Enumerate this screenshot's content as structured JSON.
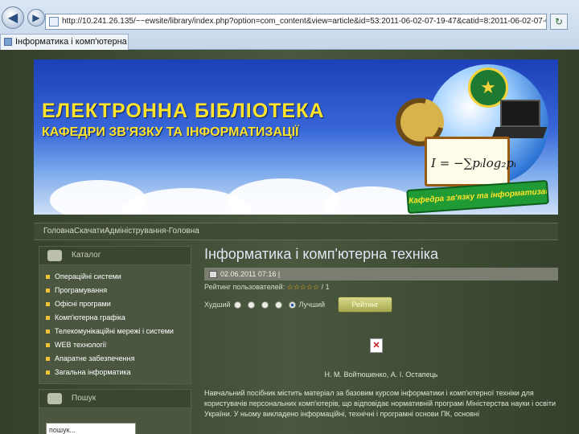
{
  "browser": {
    "url": "http://10.241.26.135/~~ewsite/library/index.php?option=com_content&view=article&id=53:2011-06-02-07-19-47&catid=8:2011-06-02-07-08-57&Itemid=",
    "tab_title": "Інформатика і комп'ютерна",
    "favorites": [
      "...",
      "...",
      "...",
      "...",
      "..."
    ]
  },
  "banner": {
    "title": "ЕЛЕКТРОННА БІБЛІОТЕКА",
    "subtitle": "КАФЕДРИ ЗВ'ЯЗКУ ТА ІНФОРМАТИЗАЦІЇ",
    "formula": "I = −∑pᵢlog₂pᵢ",
    "ribbon": "Кафедра зв'язку та інформатизації"
  },
  "breadcrumb": "ГоловнаСкачатиАдміністрування-Головна",
  "sidebar": {
    "catalog_title": "Каталог",
    "catalog_items": [
      "Операційні системи",
      "Програмування",
      "Офісні програми",
      "Комп'ютерна графіка",
      "Телекомунікаційні мережі і системи",
      "WEB технології",
      "Апаратне забезпечення",
      "Загальна інформатика"
    ],
    "poll_title": "Пошук",
    "search_value": "пошук..."
  },
  "article": {
    "title": "Інформатика і комп'ютерна техніка",
    "date": "02.06.2011 07:16 |",
    "rating_label": "Рейтинг пользователей:",
    "rating_stars": "☆☆☆☆☆",
    "rating_suffix": "/ 1",
    "poor_label": "Худший",
    "best_label": "Лучший",
    "rate_button": "Рейтинг",
    "authors": "Н. М. Войтюшенко, А. І. Остапець",
    "abstract": "Навчальний посібник містить матеріал за базовим курсом інформатики і комп'ютерної техніки для користувачів персональних комп'ютерів, що відповідає нормативній програмі Міністерства науки і освіти України. У ньому викладено інформаційні, технічні і програмні основи ПК, основні"
  }
}
